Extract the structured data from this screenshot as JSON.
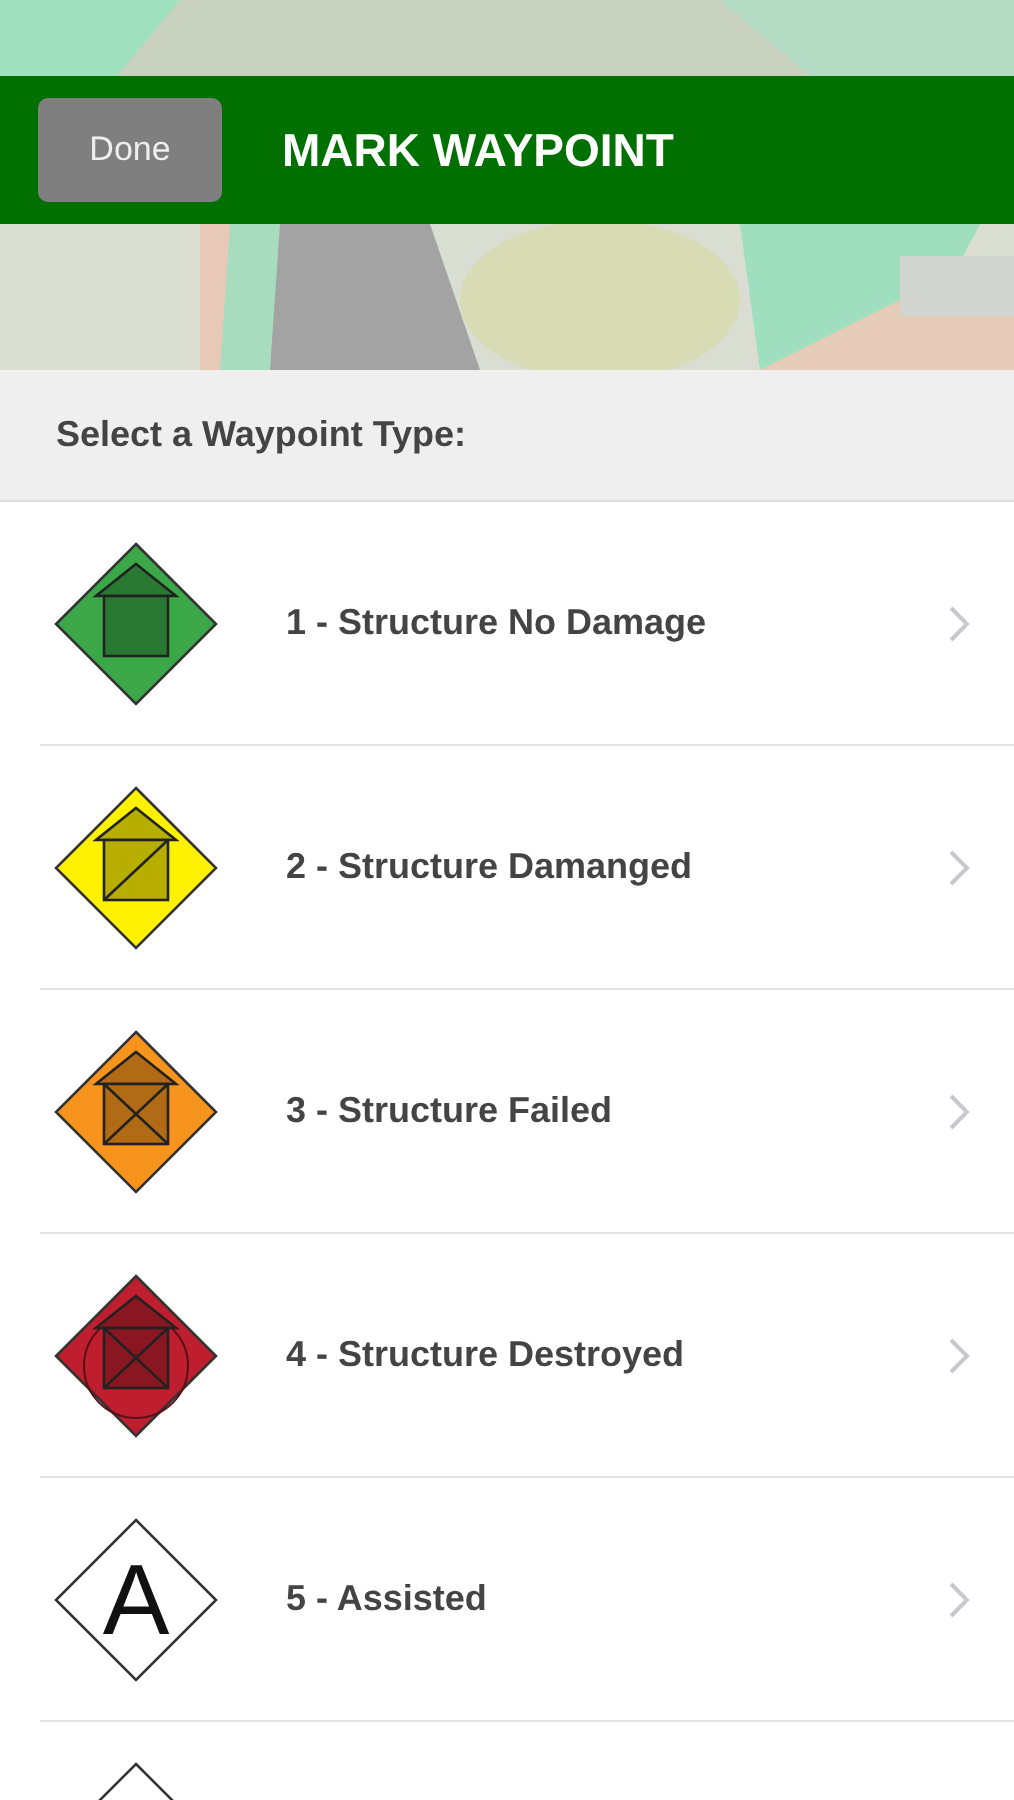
{
  "header": {
    "done_button": "Done",
    "title": "MARK WAYPOINT"
  },
  "section_title": "Select a Waypoint Type:",
  "waypoint_types": [
    {
      "kind": "intact",
      "color": "#3aa847",
      "label": "1 - Structure No Damage"
    },
    {
      "kind": "damaged",
      "color": "#fff200",
      "label": "2 - Structure Damanged"
    },
    {
      "kind": "failed",
      "color": "#f7941d",
      "label": "3 - Structure Failed"
    },
    {
      "kind": "destroyed",
      "color": "#be1e2d",
      "label": "4 - Structure Destroyed"
    },
    {
      "kind": "letter",
      "letter": "A",
      "label": "5 - Assisted"
    },
    {
      "kind": "letter"
    }
  ]
}
